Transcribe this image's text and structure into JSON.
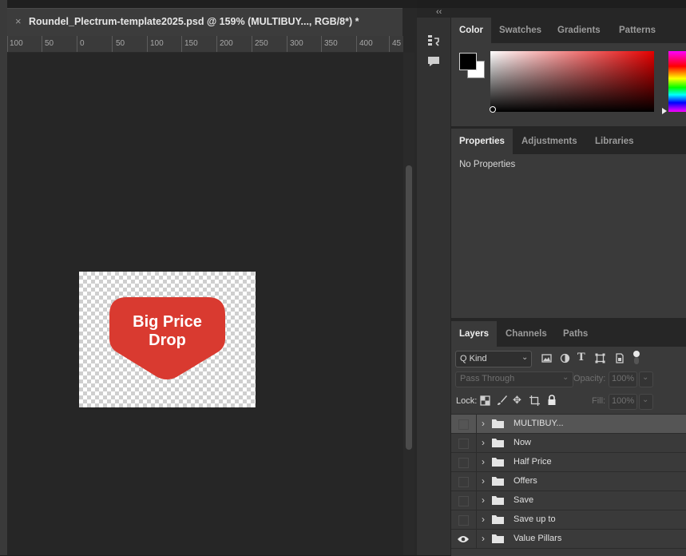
{
  "document": {
    "tab_close": "×",
    "title": "Roundel_Plectrum-template2025.psd @ 159% (MULTIBUY..., RGB/8*) *",
    "ruler_labels": [
      "100",
      "50",
      "0",
      "50",
      "100",
      "150",
      "200",
      "250",
      "300",
      "350",
      "400",
      "45"
    ],
    "roundel": {
      "line1": "Big Price",
      "line2": "Drop",
      "color": "#d93a30"
    }
  },
  "dock": {
    "collapse_label": "‹‹",
    "strip_icons": [
      "history-icon",
      "comment-icon"
    ]
  },
  "color_panel": {
    "tabs": [
      "Color",
      "Swatches",
      "Gradients",
      "Patterns"
    ],
    "foreground": "#000000",
    "background": "#ffffff"
  },
  "properties_panel": {
    "tabs": [
      "Properties",
      "Adjustments",
      "Libraries"
    ],
    "empty_text": "No Properties"
  },
  "layers_panel": {
    "tabs": [
      "Layers",
      "Channels",
      "Paths"
    ],
    "filter_label": "Q Kind",
    "blend_mode": "Pass Through",
    "opacity_label": "Opacity:",
    "opacity_value": "100%",
    "lock_label": "Lock:",
    "fill_label": "Fill:",
    "fill_value": "100%",
    "layers": [
      {
        "name": "MULTIBUY...",
        "visible": false,
        "selected": true
      },
      {
        "name": "Now",
        "visible": false,
        "selected": false
      },
      {
        "name": "Half Price",
        "visible": false,
        "selected": false
      },
      {
        "name": "Offers",
        "visible": false,
        "selected": false
      },
      {
        "name": "Save",
        "visible": false,
        "selected": false
      },
      {
        "name": "Save up to",
        "visible": false,
        "selected": false
      },
      {
        "name": "Value Pillars",
        "visible": true,
        "selected": false
      }
    ]
  }
}
